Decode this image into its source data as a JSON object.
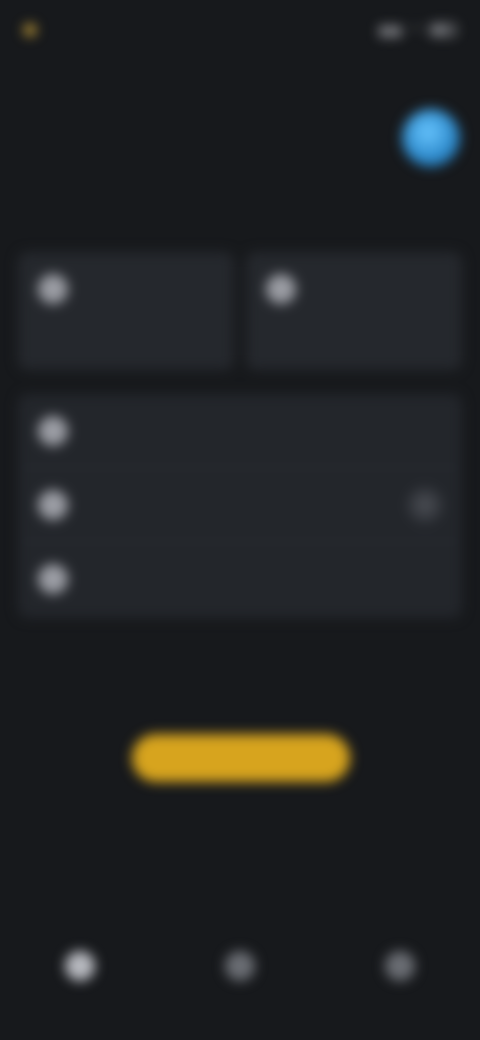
{
  "status_bar": {
    "time": "",
    "icons": [
      "signal-icon",
      "wifi-icon",
      "battery-icon"
    ]
  },
  "header": {
    "title": "",
    "avatar_color": "#2a86c8"
  },
  "section": {
    "label": ""
  },
  "tiles": [
    {
      "label": "",
      "icon": "device-icon"
    },
    {
      "label": "",
      "icon": "device-icon"
    }
  ],
  "list": [
    {
      "label": "",
      "icon": "item-icon"
    },
    {
      "label": "",
      "icon": "item-icon",
      "has_chevron": true
    },
    {
      "label": "",
      "icon": "item-icon"
    }
  ],
  "favorites": {
    "title": "",
    "link": ""
  },
  "primary_button": {
    "label": "",
    "color": "#d7a41e"
  },
  "recent": {
    "title": "",
    "link": ""
  },
  "bottom_nav": [
    {
      "label": "",
      "icon": "home-icon"
    },
    {
      "label": "",
      "icon": "discover-icon"
    },
    {
      "label": "",
      "icon": "profile-icon"
    }
  ],
  "colors": {
    "background": "#17191c",
    "card": "#25282d",
    "accent": "#2a8cc4"
  }
}
